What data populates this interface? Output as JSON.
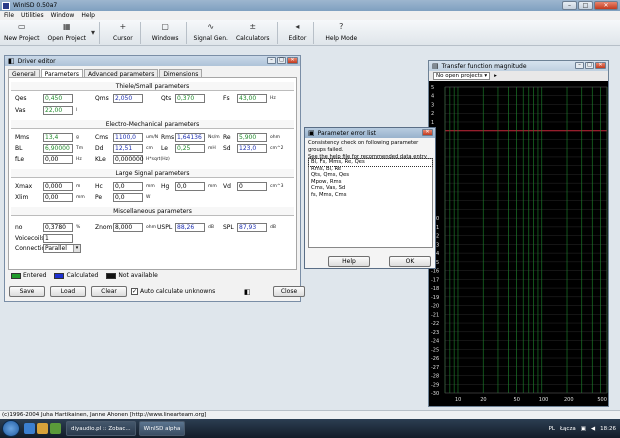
{
  "window": {
    "title": "WinISD 0.50a7",
    "controls": [
      "–",
      "□",
      "✕"
    ]
  },
  "menu": [
    "File",
    "Utilities",
    "Window",
    "Help"
  ],
  "toolbar": [
    {
      "icon": "new-file-icon",
      "glyph": "▭",
      "label": "New Project"
    },
    {
      "icon": "open-folder-icon",
      "glyph": "▦",
      "label": "Open Project"
    },
    {
      "icon": "dropdown-icon",
      "glyph": "▾",
      "label": ""
    },
    {
      "icon": "cursor-icon",
      "glyph": "+",
      "label": "Cursor"
    },
    {
      "icon": "windows-icon",
      "glyph": "▢",
      "label": "Windows"
    },
    {
      "icon": "signal-gen-icon",
      "glyph": "∿",
      "label": "Signal Gen."
    },
    {
      "icon": "calculator-icon",
      "glyph": "±",
      "label": "Calculators"
    },
    {
      "icon": "editor-icon",
      "glyph": "◂",
      "label": "Editor"
    },
    {
      "icon": "help-icon",
      "glyph": "?",
      "label": "Help Mode"
    }
  ],
  "driver_editor": {
    "title": "Driver editor",
    "tabs": [
      "General",
      "Parameters",
      "Advanced parameters",
      "Dimensions"
    ],
    "active_tab": "Parameters",
    "sections": {
      "thiele_small": "Thiele/Small parameters",
      "electro_mech": "Electro-Mechanical parameters",
      "large_signal": "Large Signal parameters",
      "misc": "Miscellaneous parameters"
    },
    "fields": {
      "qes": {
        "label": "Qes",
        "value": "0,450",
        "unit": ""
      },
      "qms": {
        "label": "Qms",
        "value": "2,050",
        "unit": ""
      },
      "qts": {
        "label": "Qts",
        "value": "0,370",
        "unit": ""
      },
      "fs": {
        "label": "Fs",
        "value": "43,00",
        "unit": "Hz"
      },
      "vas": {
        "label": "Vas",
        "value": "22,00",
        "unit": "l"
      },
      "mms": {
        "label": "Mms",
        "value": "13,4",
        "unit": "g"
      },
      "cms": {
        "label": "Cms",
        "value": "1100,0",
        "unit": "um/N"
      },
      "rms": {
        "label": "Rms",
        "value": "1,64136",
        "unit": "Ns/m"
      },
      "re": {
        "label": "Re",
        "value": "5,900",
        "unit": "ohm"
      },
      "bl": {
        "label": "BL",
        "value": "6,90000",
        "unit": "Tm"
      },
      "dd": {
        "label": "Dd",
        "value": "12,51",
        "unit": "cm"
      },
      "le": {
        "label": "Le",
        "value": "0,25",
        "unit": "mH"
      },
      "sd": {
        "label": "Sd",
        "value": "123,0",
        "unit": "cm^2"
      },
      "fle": {
        "label": "fLe",
        "value": "0,00",
        "unit": "Hz"
      },
      "k_le": {
        "label": "KLe",
        "value": "0,000000",
        "unit": "H*sqrt(Hz)"
      },
      "xmax": {
        "label": "Xmax",
        "value": "0,000",
        "unit": "m"
      },
      "hc": {
        "label": "Hc",
        "value": "0,0",
        "unit": "mm"
      },
      "hg": {
        "label": "Hg",
        "value": "0,0",
        "unit": "mm"
      },
      "vd": {
        "label": "Vd",
        "value": "0",
        "unit": "cm^3"
      },
      "xlim": {
        "label": "Xlim",
        "value": "0,00",
        "unit": "mm"
      },
      "pe": {
        "label": "Pe",
        "value": "0,0",
        "unit": "W"
      },
      "no": {
        "label": "no",
        "value": "0,3780",
        "unit": "%"
      },
      "znom": {
        "label": "Znom",
        "value": "8,000",
        "unit": "ohm"
      },
      "uspl": {
        "label": "USPL",
        "value": "88,26",
        "unit": "dB"
      },
      "spl": {
        "label": "SPL",
        "value": "87,93",
        "unit": "dB"
      },
      "voicecoils": {
        "label": "Voicecoils",
        "value": "1"
      },
      "connection": {
        "label": "Connection",
        "value": "Parallel"
      }
    },
    "legend": [
      {
        "label": "Entered",
        "color": "#1f9a2a"
      },
      {
        "label": "Calculated",
        "color": "#1d2fd0"
      },
      {
        "label": "Not available",
        "color": "#111111"
      }
    ],
    "buttons": {
      "save": "Save",
      "load": "Load",
      "clear": "Clear",
      "close": "Close",
      "auto_calc": "Auto calculate unknowns"
    },
    "auto_calc_checked": true
  },
  "param_error": {
    "title": "Parameter error list",
    "message_line1": "Consistency check on following parameter groups failed.",
    "message_line2": "See the help file for recommended data entry procedure.",
    "items": [
      "Bl, Fs, Mms, Re, Qes",
      "Rms, Bl, Re",
      "Qts, Qms, Qes",
      "Mpow, Rms",
      "Cms, Vas, Sd",
      "fs, Mms, Cms"
    ],
    "help_button": "Help",
    "ok_button": "OK"
  },
  "transfer_function": {
    "title": "Transfer function magnitude",
    "projects_label": "No open projects",
    "y_ticks": [
      "5",
      "4",
      "3",
      "2",
      "1",
      "0",
      "-1",
      "-2",
      "-3",
      "-4",
      "-5",
      "-6",
      "-7",
      "-8",
      "-9",
      "-10",
      "-11",
      "-12",
      "-13",
      "-14",
      "-15",
      "-16",
      "-17",
      "-18",
      "-19",
      "-20",
      "-21",
      "-22",
      "-23",
      "-24",
      "-25",
      "-26",
      "-27",
      "-28",
      "-29",
      "-30"
    ],
    "x_ticks": [
      "10",
      "20",
      "50",
      "100",
      "200",
      "500"
    ],
    "reference_db": 0
  },
  "statusbar": {
    "text": "(c)1996-2004 Juha Hartikainen, Janne Ahonen [http://www.linearteam.org]"
  },
  "taskbar": {
    "tasks": [
      {
        "label": "diyaudio.pl :: Zobac...",
        "active": false
      },
      {
        "label": "WinISD alpha",
        "active": true
      }
    ],
    "tray": {
      "lang": "PL",
      "network": "Łącza",
      "time": "18:26"
    }
  }
}
